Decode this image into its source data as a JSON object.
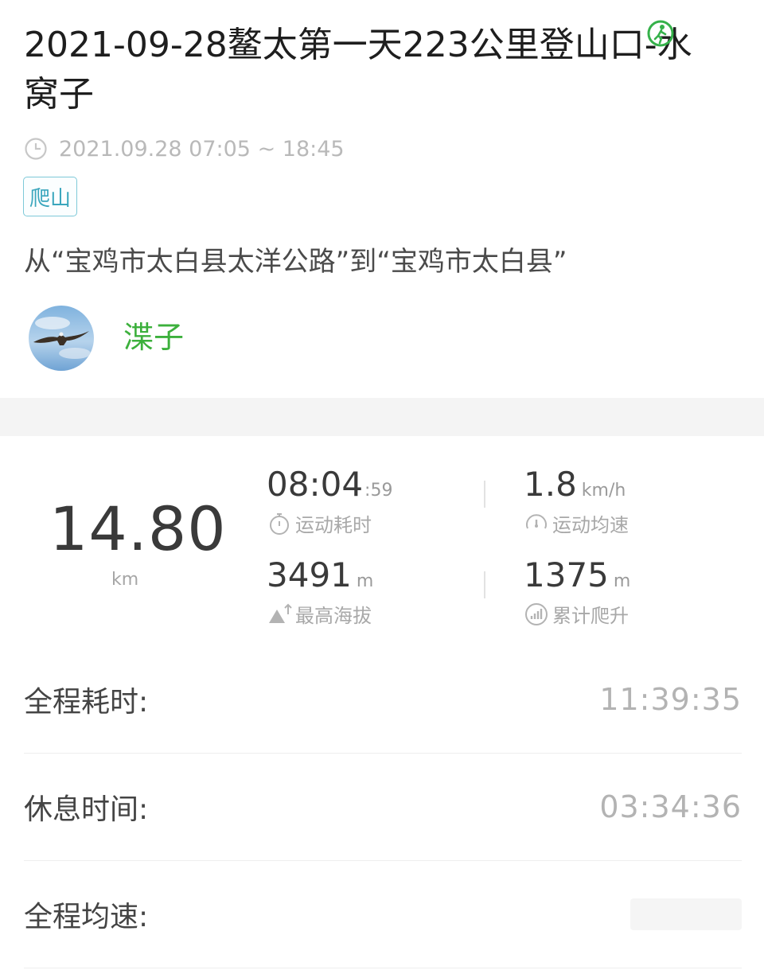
{
  "title": "2021-09-28鳌太第一天223公里登山口-水窝子",
  "time_range": "2021.09.28 07:05 ~ 18:45",
  "tag": "爬山",
  "route": "从“宝鸡市太白县太洋公路”到“宝鸡市太白县”",
  "user": {
    "name": "渫子"
  },
  "stats": {
    "distance": {
      "value": "14.80",
      "unit": "km"
    },
    "moving_time": {
      "value": "08:04",
      "seconds": ":59",
      "label": "运动耗时",
      "icon": "stopwatch-icon"
    },
    "avg_speed": {
      "value": "1.8",
      "unit": "km/h",
      "label": "运动均速",
      "icon": "speedometer-icon"
    },
    "max_altitude": {
      "value": "3491",
      "unit": "m",
      "label": "最高海拔",
      "icon": "mountain-icon"
    },
    "total_climb": {
      "value": "1375",
      "unit": "m",
      "label": "累计爬升",
      "icon": "climb-chart-icon"
    }
  },
  "details": [
    {
      "label": "全程耗时:",
      "value": "11:39:35"
    },
    {
      "label": "休息时间:",
      "value": "03:34:36"
    },
    {
      "label": "全程均速:",
      "value": ""
    }
  ],
  "colors": {
    "accent_green": "#3cb03c",
    "tag_border": "#7ec9d8",
    "tag_text": "#3aa6bd"
  }
}
